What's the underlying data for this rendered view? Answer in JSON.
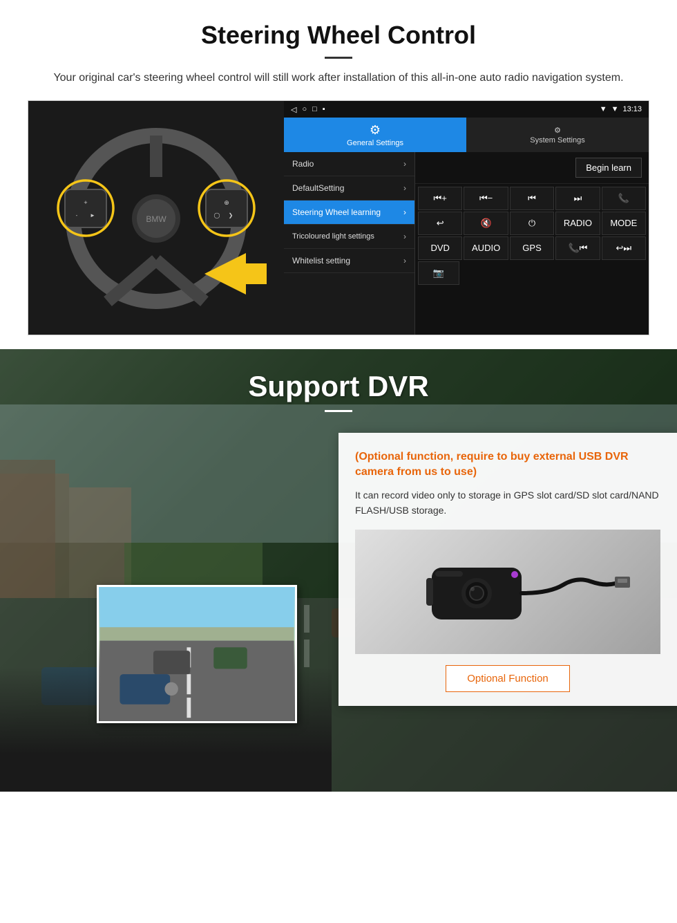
{
  "steering_section": {
    "title": "Steering Wheel Control",
    "description": "Your original car's steering wheel control will still work after installation of this all-in-one auto radio navigation system.",
    "status_bar": {
      "time": "13:13",
      "signal_icon": "▾",
      "wifi_icon": "▾",
      "battery_icon": "▉"
    },
    "nav_bar": {
      "back": "◁",
      "home": "○",
      "recent": "□",
      "more": "▪"
    },
    "tabs": {
      "general": {
        "label": "General Settings",
        "icon": "⚙"
      },
      "system": {
        "label": "System Settings",
        "icon": "🔧"
      }
    },
    "menu_items": [
      {
        "label": "Radio",
        "active": false
      },
      {
        "label": "DefaultSetting",
        "active": false
      },
      {
        "label": "Steering Wheel learning",
        "active": true
      },
      {
        "label": "Tricoloured light settings",
        "active": false
      },
      {
        "label": "Whitelist setting",
        "active": false
      }
    ],
    "begin_learn_label": "Begin learn",
    "control_buttons": [
      [
        "⏮+",
        "⏮-",
        "⏭⏮",
        "⏭⏭",
        "📞"
      ],
      [
        "↩",
        "🔇x",
        "⏻",
        "RADIO",
        "MODE"
      ],
      [
        "DVD",
        "AUDIO",
        "GPS",
        "📞⏮",
        "↩⏭"
      ]
    ]
  },
  "dvr_section": {
    "title": "Support DVR",
    "optional_title": "(Optional function, require to buy external USB DVR camera from us to use)",
    "description": "It can record video only to storage in GPS slot card/SD slot card/NAND FLASH/USB storage.",
    "optional_btn_label": "Optional Function"
  }
}
